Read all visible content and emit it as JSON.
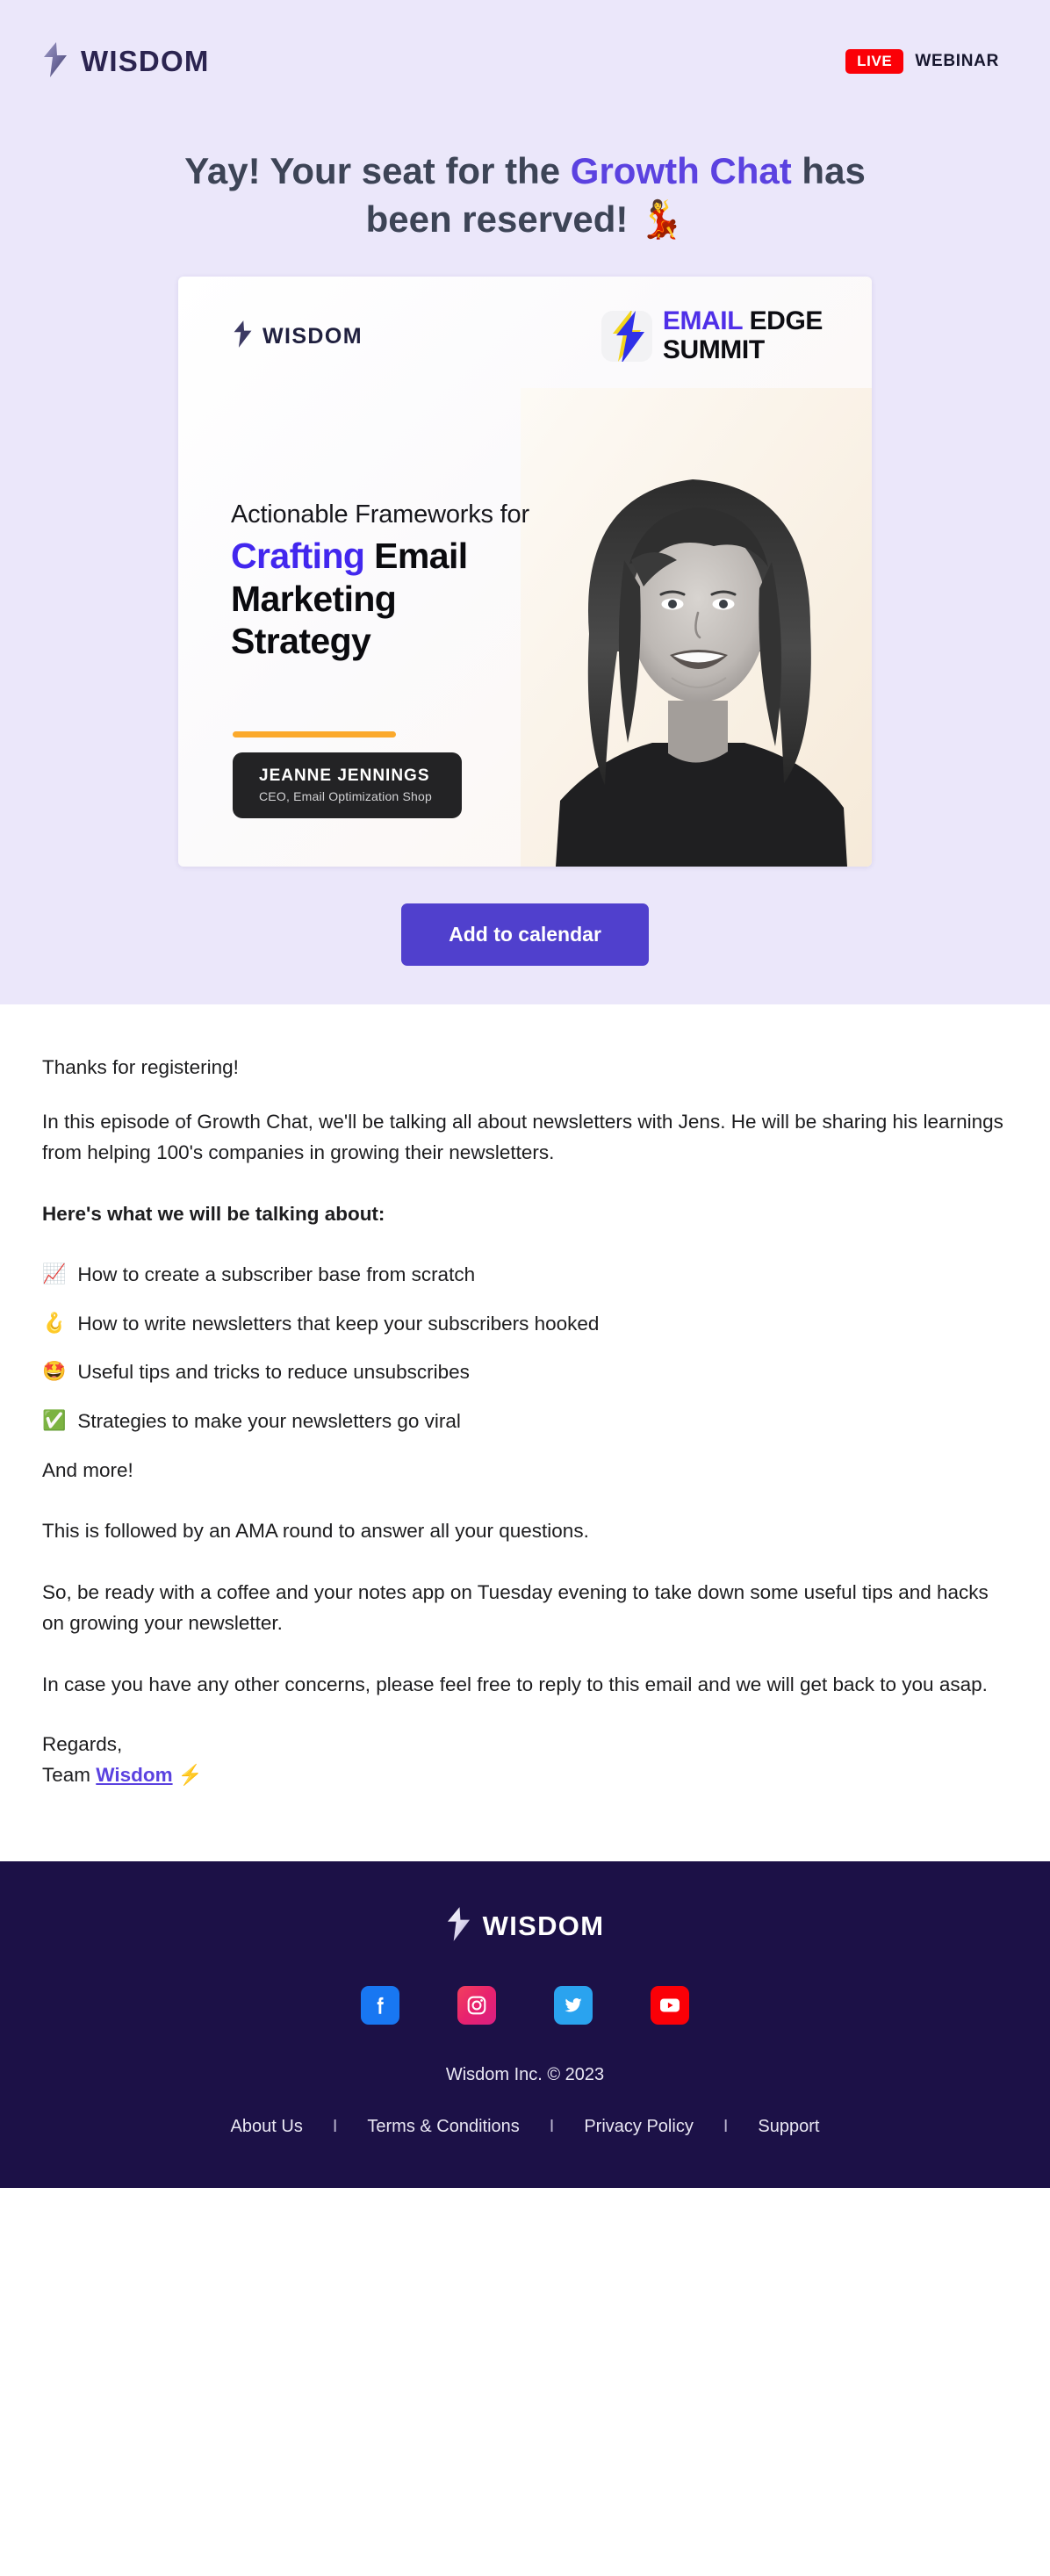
{
  "header": {
    "brand_name": "WISDOM",
    "logo_icon": "lightning-bolt-icon",
    "live_badge": "LIVE",
    "webinar_label": "WEBINAR"
  },
  "hero": {
    "headline_pre": "Yay! Your seat for the ",
    "headline_accent": "Growth Chat",
    "headline_post": " has been reserved! ",
    "headline_emoji": "💃",
    "accent_color": "#5b42e0",
    "background_color": "#ebe7fa"
  },
  "hero_card": {
    "brand_name": "WISDOM",
    "summit_email": "EMAIL",
    "summit_edge": " EDGE",
    "summit_summit": "SUMMIT",
    "title_line1": "Actionable Frameworks for",
    "title_accent": "Crafting",
    "title_rest": " Email",
    "title_line3": "Marketing",
    "title_line4": "Strategy",
    "speaker_name": "JEANNE JENNINGS",
    "speaker_role": "CEO, Email Optimization Shop",
    "rule_color": "#fba92c",
    "accent_color": "#4227ee"
  },
  "cta": {
    "label": "Add to calendar",
    "color": "#5040cd"
  },
  "body": {
    "greeting": "Thanks for registering!",
    "intro": "In this episode of Growth Chat, we'll be talking all about newsletters with Jens. He will be sharing his learnings from helping 100's companies in growing their newsletters.",
    "topics_heading": "Here's what we will be talking about:",
    "topics": [
      {
        "emoji": "📈",
        "icon_name": "chart-increasing-icon",
        "text": "How to create a subscriber base from scratch"
      },
      {
        "emoji": "🪝",
        "icon_name": "hook-icon",
        "text": "How to write newsletters that keep your subscribers hooked"
      },
      {
        "emoji": "🤩",
        "icon_name": "star-struck-icon",
        "text": "Useful tips and tricks to reduce unsubscribes"
      },
      {
        "emoji": "✅",
        "icon_name": "check-mark-button-icon",
        "text": "Strategies to make your newsletters go viral"
      }
    ],
    "and_more": "And more!",
    "ama": "This is followed by an AMA round to answer all your questions.",
    "prep": "So, be ready with a coffee and your notes app on Tuesday evening to take down some useful tips and hacks on growing your newsletter.",
    "concerns": "In case you have any other concerns, please feel free to reply to this email and we will get back to you asap.",
    "regards": "Regards,",
    "team_prefix": "Team ",
    "team_link": "Wisdom",
    "team_emoji": " ⚡"
  },
  "footer": {
    "brand_name": "WISDOM",
    "background_color": "#1c1147",
    "socials": [
      {
        "name": "facebook-icon",
        "label": "Facebook",
        "color": "#1877f2"
      },
      {
        "name": "instagram-icon",
        "label": "Instagram",
        "color": "#e8226e"
      },
      {
        "name": "twitter-icon",
        "label": "Twitter",
        "color": "#2aa3ef"
      },
      {
        "name": "youtube-icon",
        "label": "YouTube",
        "color": "#fb0007"
      }
    ],
    "copyright": "Wisdom Inc. © 2023",
    "links": [
      {
        "label": "About Us"
      },
      {
        "label": "Terms & Conditions"
      },
      {
        "label": "Privacy Policy"
      },
      {
        "label": "Support"
      }
    ],
    "separator": "I"
  }
}
